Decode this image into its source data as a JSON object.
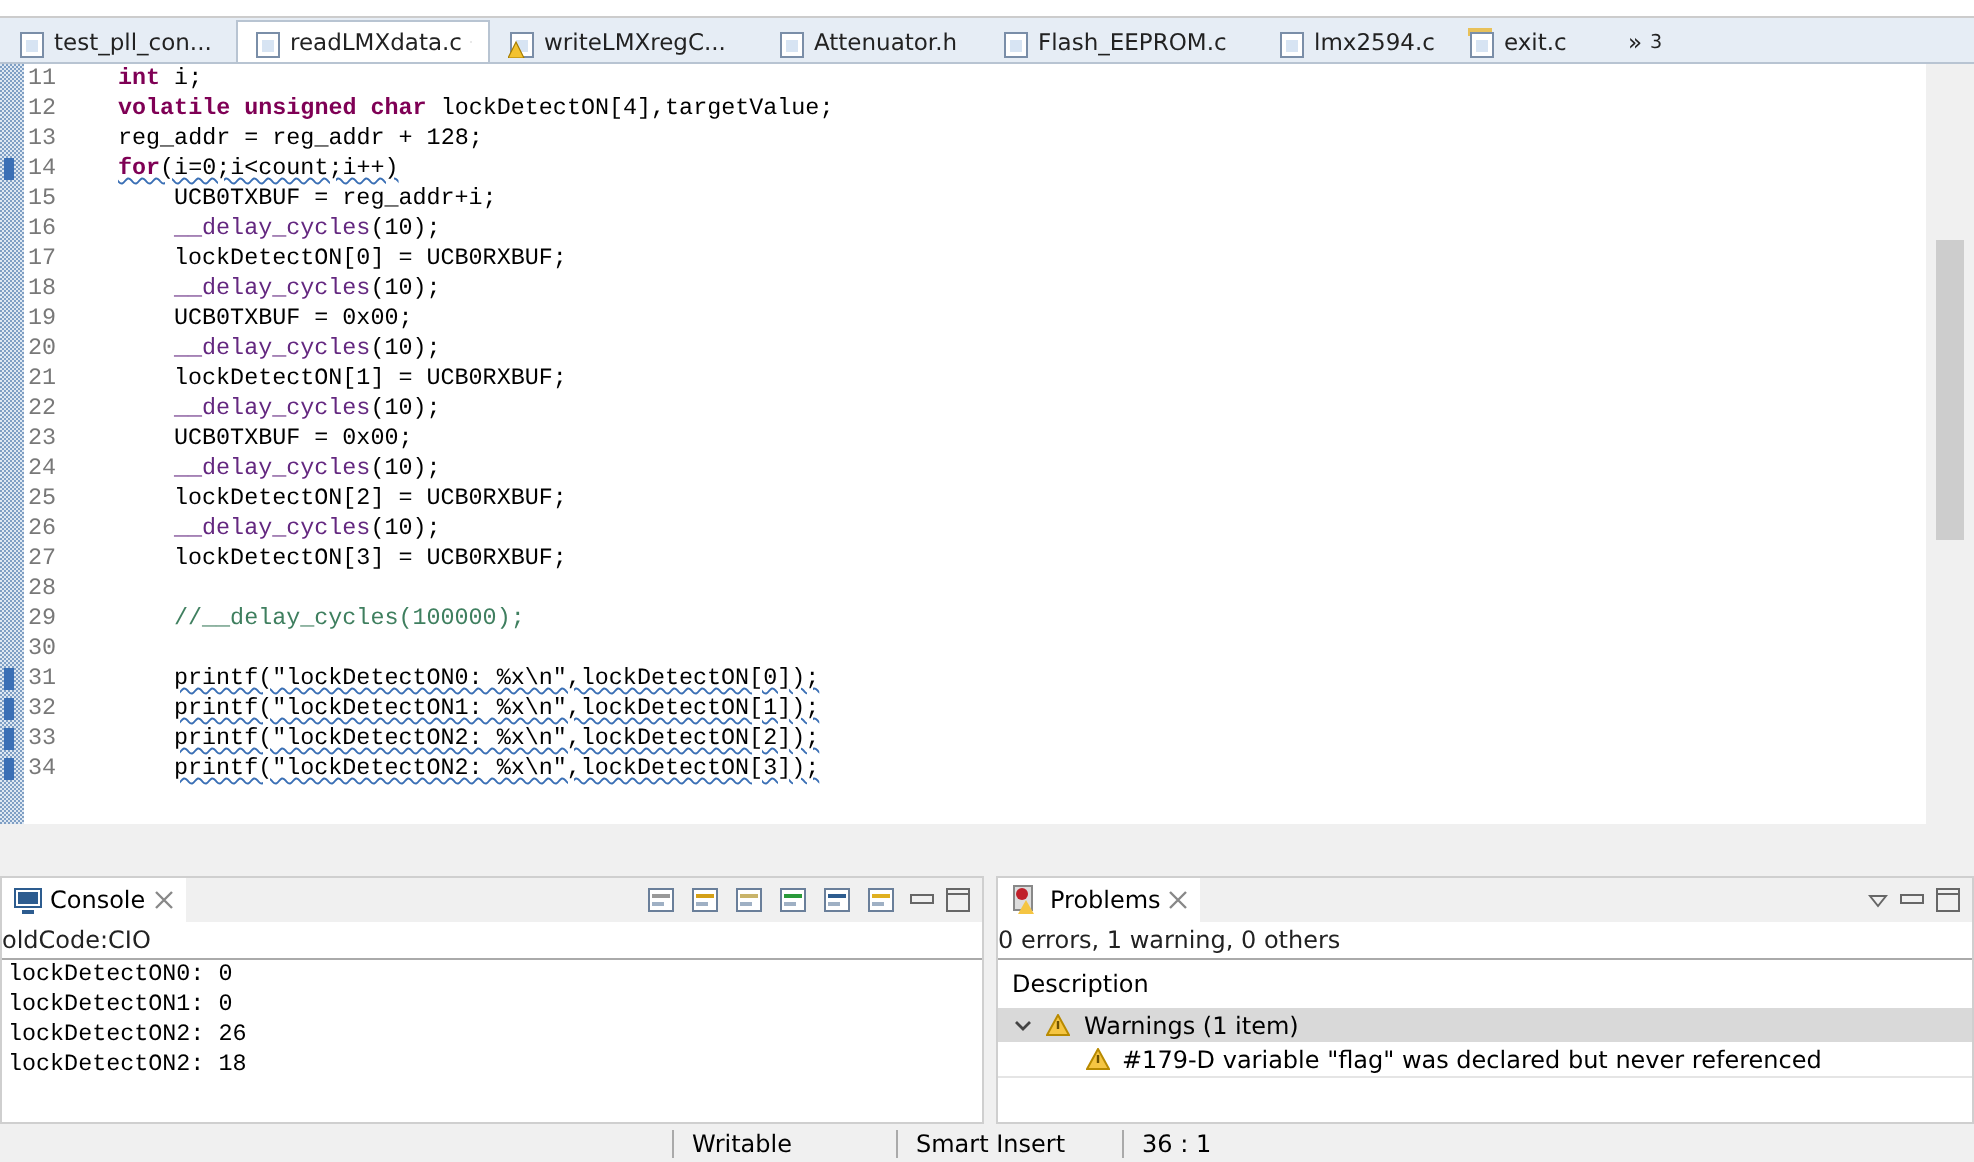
{
  "editor_tabs": [
    {
      "label": "test_pll_con...",
      "kind": "c",
      "warning": false,
      "selected": false
    },
    {
      "label": "readLMXdata.c",
      "kind": "c",
      "warning": false,
      "selected": true
    },
    {
      "label": "writeLMXregC...",
      "kind": "c",
      "warning": true,
      "selected": false
    },
    {
      "label": "Attenuator.h",
      "kind": "h",
      "warning": false,
      "selected": false
    },
    {
      "label": "Flash_EEPROM.c",
      "kind": "c",
      "warning": false,
      "selected": false
    },
    {
      "label": "lmx2594.c",
      "kind": "c",
      "warning": false,
      "selected": false
    },
    {
      "label": "exit.c",
      "kind": "c-folder",
      "warning": false,
      "selected": false
    }
  ],
  "tab_overflow": {
    "label": "»",
    "count": "3"
  },
  "code_lines": [
    {
      "number": "11",
      "marker": false,
      "tokens": [
        {
          "kind": "keyword",
          "text": "int"
        },
        {
          "kind": "plain",
          "text": " i;"
        }
      ]
    },
    {
      "number": "12",
      "marker": false,
      "tokens": [
        {
          "kind": "keyword",
          "text": "volatile unsigned char"
        },
        {
          "kind": "plain",
          "text": " lockDetectON[4],targetValue;"
        }
      ]
    },
    {
      "number": "13",
      "marker": false,
      "tokens": [
        {
          "kind": "plain",
          "text": "reg_addr = reg_addr + 128;"
        }
      ]
    },
    {
      "number": "14",
      "marker": true,
      "tokens": [
        {
          "kind": "keyword-squiggle",
          "text": "for"
        },
        {
          "kind": "squiggle",
          "text": "(i=0;i<count;i++)"
        }
      ],
      "children": [
        {
          "number": "15",
          "marker": false,
          "tokens": [
            {
              "kind": "plain",
              "text": "UCB0TXBUF = reg_addr+i;"
            }
          ]
        },
        {
          "number": "16",
          "marker": false,
          "tokens": [
            {
              "kind": "function",
              "text": "__delay_cycles"
            },
            {
              "kind": "plain",
              "text": "(10);"
            }
          ]
        },
        {
          "number": "17",
          "marker": false,
          "tokens": [
            {
              "kind": "plain",
              "text": "lockDetectON[0] = UCB0RXBUF;"
            }
          ]
        },
        {
          "number": "18",
          "marker": false,
          "tokens": [
            {
              "kind": "function",
              "text": "__delay_cycles"
            },
            {
              "kind": "plain",
              "text": "(10);"
            }
          ]
        },
        {
          "number": "19",
          "marker": false,
          "tokens": [
            {
              "kind": "plain",
              "text": "UCB0TXBUF = 0x00;"
            }
          ]
        },
        {
          "number": "20",
          "marker": false,
          "tokens": [
            {
              "kind": "function",
              "text": "__delay_cycles"
            },
            {
              "kind": "plain",
              "text": "(10);"
            }
          ]
        },
        {
          "number": "21",
          "marker": false,
          "tokens": [
            {
              "kind": "plain",
              "text": "lockDetectON[1] = UCB0RXBUF;"
            }
          ]
        },
        {
          "number": "22",
          "marker": false,
          "tokens": [
            {
              "kind": "function",
              "text": "__delay_cycles"
            },
            {
              "kind": "plain",
              "text": "(10);"
            }
          ]
        },
        {
          "number": "23",
          "marker": false,
          "tokens": [
            {
              "kind": "plain",
              "text": "UCB0TXBUF = 0x00;"
            }
          ]
        },
        {
          "number": "24",
          "marker": false,
          "tokens": [
            {
              "kind": "function",
              "text": "__delay_cycles"
            },
            {
              "kind": "plain",
              "text": "(10);"
            }
          ]
        },
        {
          "number": "25",
          "marker": false,
          "tokens": [
            {
              "kind": "plain",
              "text": "lockDetectON[2] = UCB0RXBUF;"
            }
          ]
        },
        {
          "number": "26",
          "marker": false,
          "tokens": [
            {
              "kind": "function",
              "text": "__delay_cycles"
            },
            {
              "kind": "plain",
              "text": "(10);"
            }
          ]
        },
        {
          "number": "27",
          "marker": false,
          "tokens": [
            {
              "kind": "plain",
              "text": "lockDetectON[3] = UCB0RXBUF;"
            }
          ]
        },
        {
          "number": "28",
          "marker": false
        },
        {
          "number": "29",
          "marker": false,
          "tokens": [
            {
              "kind": "comment",
              "text": "//__delay_cycles(100000);"
            }
          ]
        },
        {
          "number": "30",
          "marker": false
        },
        {
          "number": "31",
          "marker": true,
          "tokens": [
            {
              "kind": "squiggle",
              "text": "printf(\"lockDetectON0: %x\\n\",lockDetectON[0]);"
            }
          ]
        },
        {
          "number": "32",
          "marker": true,
          "tokens": [
            {
              "kind": "squiggle",
              "text": "printf(\"lockDetectON1: %x\\n\",lockDetectON[1]);"
            }
          ]
        },
        {
          "number": "33",
          "marker": true,
          "tokens": [
            {
              "kind": "squiggle",
              "text": "printf(\"lockDetectON2: %x\\n\",lockDetectON[2]);"
            }
          ]
        },
        {
          "number": "34",
          "marker": true,
          "tokens": [
            {
              "kind": "squiggle",
              "text": "printf(\"lockDetectON2: %x\\n\",lockDetectON[3]);"
            }
          ]
        }
      ]
    }
  ],
  "console": {
    "title": "Console",
    "header": "oldCode:CIO",
    "lines": [
      "lockDetectON0: 0",
      "lockDetectON1: 0",
      "lockDetectON2: 26",
      "lockDetectON2: 18"
    ]
  },
  "problems": {
    "title": "Problems",
    "summary": "0 errors, 1 warning, 0 others",
    "column": "Description",
    "groups": [
      {
        "label": "Warnings (1 item)",
        "expanded": true,
        "items": [
          "#179-D variable \"flag\" was declared but never referenced"
        ]
      }
    ]
  },
  "status_bar": [
    "Writable",
    "Smart Insert",
    "36 : 1"
  ]
}
